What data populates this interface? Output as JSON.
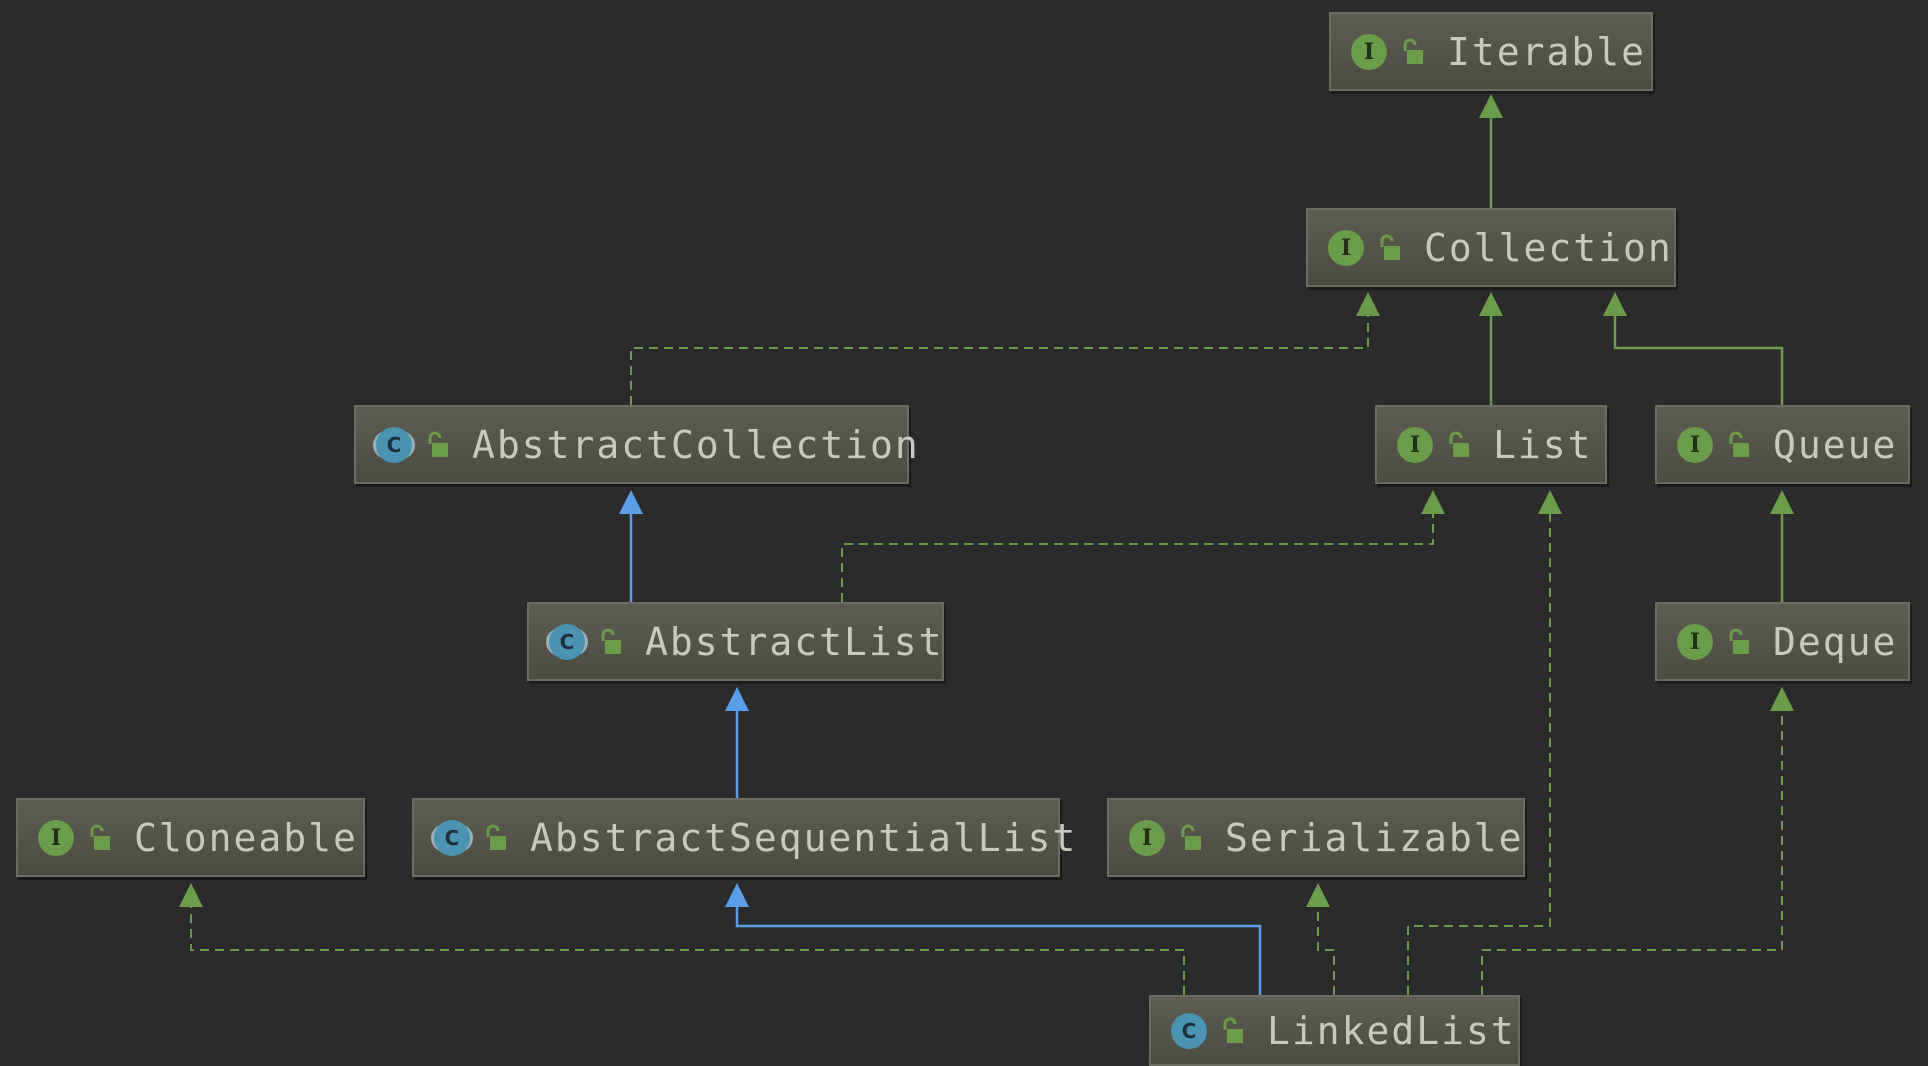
{
  "nodes": {
    "iterable": {
      "label": "Iterable",
      "kind": "I"
    },
    "collection": {
      "label": "Collection",
      "kind": "I"
    },
    "abstract_collection": {
      "label": "AbstractCollection",
      "kind": "C"
    },
    "list": {
      "label": "List",
      "kind": "I"
    },
    "queue": {
      "label": "Queue",
      "kind": "I"
    },
    "abstract_list": {
      "label": "AbstractList",
      "kind": "C"
    },
    "deque": {
      "label": "Deque",
      "kind": "I"
    },
    "cloneable": {
      "label": "Cloneable",
      "kind": "I"
    },
    "abstract_sequential_list": {
      "label": "AbstractSequentialList",
      "kind": "C"
    },
    "serializable": {
      "label": "Serializable",
      "kind": "I"
    },
    "linked_list": {
      "label": "LinkedList",
      "kind": "C"
    }
  },
  "colors": {
    "background": "#2b2b2b",
    "node_fill": "#56554b",
    "node_border": "#6d6c62",
    "node_text": "#c9c9c1",
    "interface_badge": "#6a9c4a",
    "class_badge": "#4b93b3",
    "extends_edge": "#5a9ee8",
    "interface_edge": "#6a9c4a"
  },
  "icons": {
    "interface": "interface-badge-icon",
    "class": "class-badge-icon",
    "abstract_class": "abstract-class-badge-icon",
    "visibility": "public-lock-icon"
  }
}
